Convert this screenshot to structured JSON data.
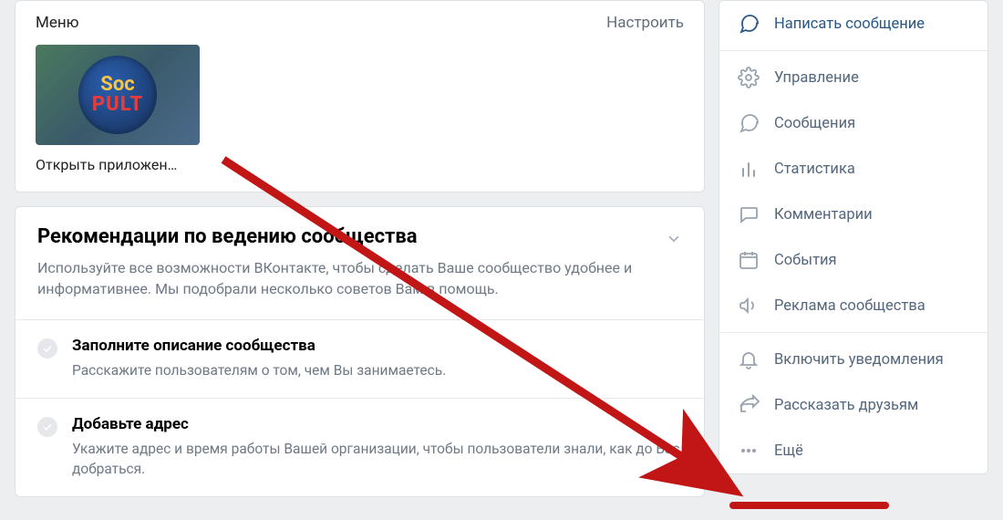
{
  "menu": {
    "title": "Меню",
    "configure": "Настроить",
    "app": {
      "logo_top": "Soc",
      "logo_bottom": "PULT",
      "caption": "Открыть приложен…"
    }
  },
  "recs": {
    "title": "Рекомендации по ведению сообщества",
    "subtitle": "Используйте все возможности ВКонтакте, чтобы сделать Ваше сообщество удобнее и информативнее. Мы подобрали несколько советов Вам в помощь.",
    "items": [
      {
        "title": "Заполните описание сообщества",
        "sub": "Расскажите пользователям о том, чем Вы занимаетесь."
      },
      {
        "title": "Добавьте адрес",
        "sub": "Укажите адрес и время работы Вашей организации, чтобы пользователи знали, как до Вас добраться."
      }
    ]
  },
  "sidebar": {
    "groups": [
      [
        {
          "icon": "message-icon",
          "label": "Написать сообщение",
          "primary": true
        }
      ],
      [
        {
          "icon": "gear-icon",
          "label": "Управление"
        },
        {
          "icon": "chat-icon",
          "label": "Сообщения"
        },
        {
          "icon": "stats-icon",
          "label": "Статистика"
        },
        {
          "icon": "comment-icon",
          "label": "Комментарии"
        },
        {
          "icon": "calendar-icon",
          "label": "События"
        },
        {
          "icon": "megaphone-icon",
          "label": "Реклама сообщества"
        }
      ],
      [
        {
          "icon": "bell-icon",
          "label": "Включить уведомления"
        },
        {
          "icon": "share-icon",
          "label": "Рассказать друзьям"
        },
        {
          "icon": "dots-icon",
          "label": "Ещё"
        }
      ]
    ]
  }
}
